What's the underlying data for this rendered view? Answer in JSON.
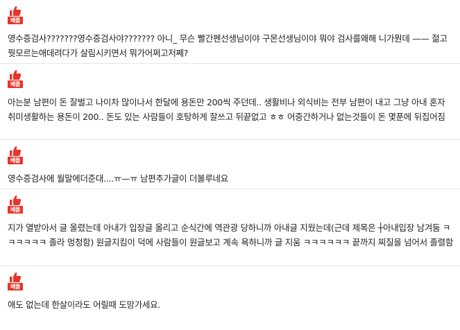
{
  "badge": {
    "label": "베플",
    "icon": "thumbs-up-icon",
    "color": "#e8352b"
  },
  "comments": [
    {
      "text": "영수증검사???????영수증검사야??????? 아니_ 무슨 빨간펜선생님이야 구몬선생님이야 뭐야 검사를왜해 니가뭔데 —— 젊고뭣모르는애데려다가 살림시키면서 뭐가어쩌고저쩨?"
    },
    {
      "text": "아는분 남편이 돈 잘벌고 나이차 많이나서 한달에 용돈만 200씩 주던데.. 생활비나 외식비는 전부 남편이 내고 그냥 아내 혼자 취미생활하는 용돈이 200.. 돈도 있는 사람들이 호탕하게 잘쓰고 뒤끝없고 ㅎㅎ 어중간하거나 없는것들이 돈 몇푼에 뒤집어짐"
    },
    {
      "text": "영수증검사에 월말에더준대....ㅠ—ㅠ 남편추가글이 더볼루네요"
    },
    {
      "text": "지가 열받아서 글 올렸는데 아내가 입장글 올리고 순식간에 역관광 당하니까 아내글 지웠는데(근데 제목은 ┼아내입장 남겨둠 ㅋㅋㅋㅋㅋㅋ 졸라 멍청함) 원글지킴이 덕에 사람들이 원글보고 계속 욕하니까 글 지움 ㅋㅋㅋㅋㅋㅋ 끝까지 찌질을 넘어서 졸렬함"
    },
    {
      "text": "애도 없는데 한살이라도 어릴때 도망가세요."
    }
  ]
}
